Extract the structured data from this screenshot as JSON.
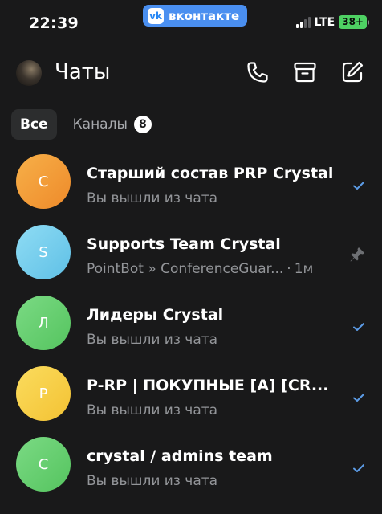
{
  "status_bar": {
    "time": "22:39",
    "app_pill": "вконтакте",
    "vk_logo": "vk",
    "network": "LTE",
    "battery": "38+"
  },
  "header": {
    "title": "Чаты"
  },
  "tabs": [
    {
      "label": "Все"
    },
    {
      "label": "Каналы",
      "badge": "8"
    }
  ],
  "chats": [
    {
      "initial": "С",
      "name": "Старший состав PRP Crystal",
      "preview": "Вы вышли из чата",
      "avatar_color": "#f5a23a"
    },
    {
      "initial": "S",
      "name": "Supports Team Crystal",
      "preview": "PointBot » ConferenceGuar...",
      "time": "1м",
      "avatar_color": "#7fd3ef"
    },
    {
      "initial": "Л",
      "name": "Лидеры Crystal",
      "preview": "Вы вышли из чата",
      "avatar_color": "#6fd07a"
    },
    {
      "initial": "P",
      "name": "P-RP | ПОКУПНЫЕ [A] [CR...",
      "preview": "Вы вышли из чата",
      "avatar_color": "#f8d34c"
    },
    {
      "initial": "C",
      "name": "crystal / admins team",
      "preview": "Вы вышли из чата",
      "avatar_color": "#6fd07a"
    }
  ],
  "colors": {
    "background": "#19191a",
    "accent": "#4a8ff0",
    "read_check": "#5c9ce6"
  }
}
